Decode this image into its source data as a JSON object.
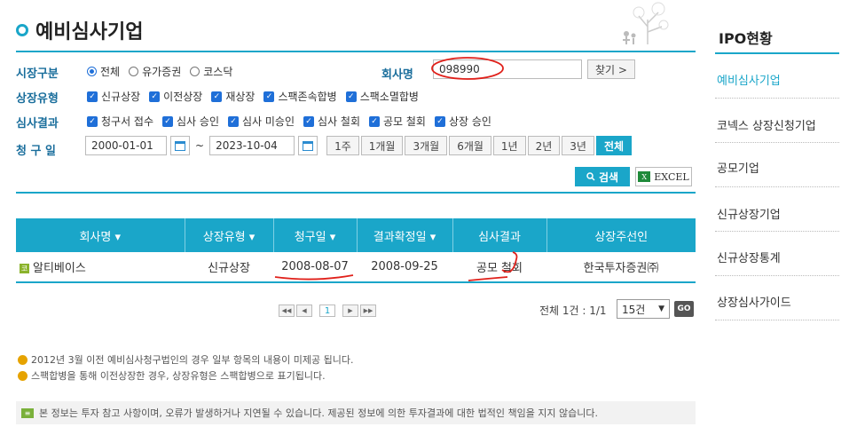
{
  "page": {
    "title": "예비심사기업"
  },
  "filters": {
    "market_label": "시장구분",
    "market_options": [
      {
        "label": "전체",
        "selected": true
      },
      {
        "label": "유가증권",
        "selected": false
      },
      {
        "label": "코스닥",
        "selected": false
      }
    ],
    "company_label": "회사명",
    "company_value": "098990",
    "find_label": "찾기 >",
    "listing_type_label": "상장유형",
    "listing_types": [
      "신규상장",
      "이전상장",
      "재상장",
      "스팩존속합병",
      "스팩소멸합병"
    ],
    "result_label": "심사결과",
    "results": [
      "청구서 접수",
      "심사 승인",
      "심사 미승인",
      "심사 철회",
      "공모 철회",
      "상장 승인"
    ],
    "date_label": "청 구 일",
    "date_from": "2000-01-01",
    "date_sep": "~",
    "date_to": "2023-10-04",
    "periods": [
      {
        "label": "1주",
        "active": false
      },
      {
        "label": "1개월",
        "active": false
      },
      {
        "label": "3개월",
        "active": false
      },
      {
        "label": "6개월",
        "active": false
      },
      {
        "label": "1년",
        "active": false
      },
      {
        "label": "2년",
        "active": false
      },
      {
        "label": "3년",
        "active": false
      },
      {
        "label": "전체",
        "active": true
      }
    ],
    "search_label": "검색",
    "excel_label": "EXCEL"
  },
  "table": {
    "headers": [
      "회사명 ▾",
      "상장유형 ▾",
      "청구일 ▾",
      "결과확정일 ▾",
      "심사결과",
      "상장주선인"
    ],
    "rows": [
      {
        "company": "알티베이스",
        "type": "신규상장",
        "request_date": "2008-08-07",
        "confirm_date": "2008-09-25",
        "result": "공모 철회",
        "underwriter": "한국투자증권㈜"
      }
    ]
  },
  "pager": {
    "current": "1",
    "total": "전체 1건 : 1/1",
    "page_size": "15건",
    "go_label": "GO"
  },
  "notes": [
    "2012년 3월 이전 예비심사청구법인의 경우 일부 항목의 내용이 미제공 됩니다.",
    "스팩합병을 통해 이전상장한 경우, 상장유형은 스팩합병으로 표기됩니다."
  ],
  "disclaimer": "본 정보는 투자 참고 사항이며, 오류가 발생하거나 지연될 수 있습니다. 제공된 정보에 의한 투자결과에 대한 법적인 책임을 지지 않습니다.",
  "sidebar": {
    "title": "IPO현황",
    "items": [
      {
        "label": "예비심사기업",
        "active": true
      },
      {
        "label": "코넥스 상장신청기업",
        "active": false
      },
      {
        "label": "공모기업",
        "active": false
      },
      {
        "label": "신규상장기업",
        "active": false
      },
      {
        "label": "신규상장통계",
        "active": false
      },
      {
        "label": "상장심사가이드",
        "active": false
      }
    ]
  },
  "colors": {
    "accent": "#1aa6c9",
    "check": "#1f6fd8",
    "annotation": "#e0201a"
  }
}
